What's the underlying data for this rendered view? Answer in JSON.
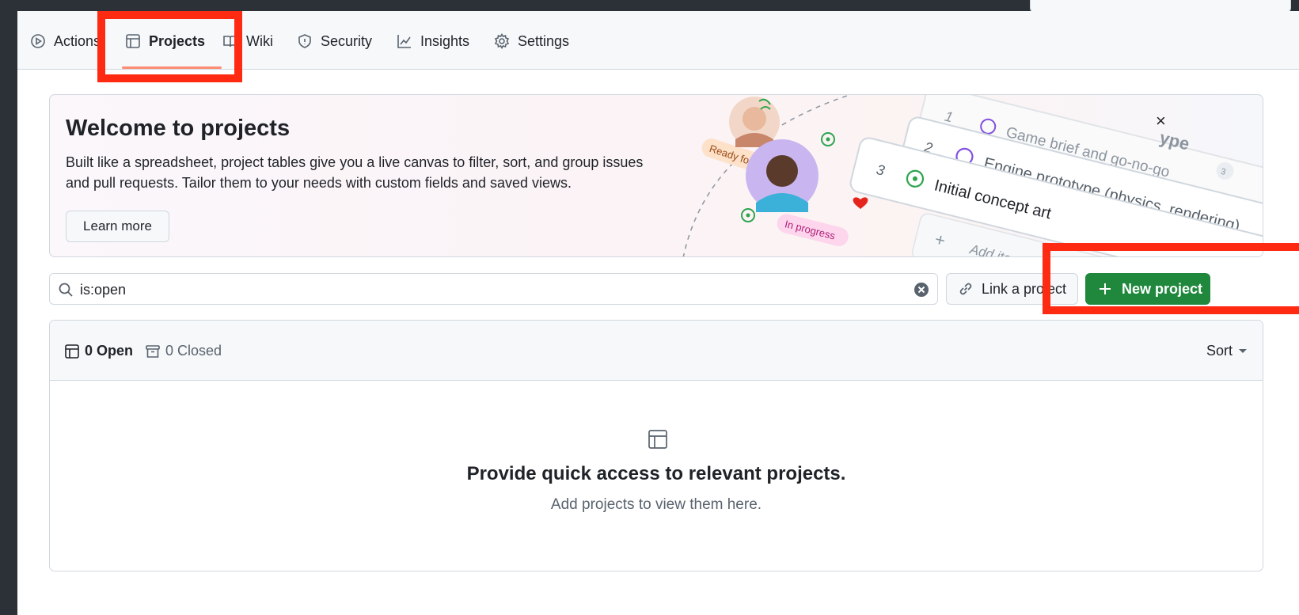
{
  "tabs": [
    {
      "label": "Actions",
      "icon": "play-icon"
    },
    {
      "label": "Projects",
      "icon": "table-icon",
      "active": true
    },
    {
      "label": "Wiki",
      "icon": "book-icon"
    },
    {
      "label": "Security",
      "icon": "shield-icon"
    },
    {
      "label": "Insights",
      "icon": "graph-icon"
    },
    {
      "label": "Settings",
      "icon": "gear-icon"
    }
  ],
  "banner": {
    "title": "Welcome to projects",
    "description": "Built like a spreadsheet, project tables give you a live canvas to filter, sort, and group issues and pull requests. Tailor them to your needs with custom fields and saved views.",
    "learn_more": "Learn more",
    "close": "×",
    "illustration": {
      "ready_label": "Ready for review",
      "progress_label": "In progress",
      "rows": [
        {
          "num": "1",
          "text": "Game brief and go-no-go"
        },
        {
          "num": "2",
          "text": "Engine prototype (physics, rendering)"
        },
        {
          "num": "3",
          "text": "Initial concept art"
        }
      ],
      "add_item": "Add item",
      "badge": "3",
      "type_fragment": "ype"
    }
  },
  "search": {
    "value": "is:open"
  },
  "link_button": "Link a project",
  "new_button": "New project",
  "list": {
    "open_label": "0 Open",
    "closed_label": "0 Closed",
    "sort_label": "Sort",
    "empty_title": "Provide quick access to relevant projects.",
    "empty_subtitle": "Add projects to view them here."
  },
  "colors": {
    "accent_green": "#1f883d",
    "annotation_red": "#ff2a12",
    "tab_underline": "#fd8c73"
  }
}
